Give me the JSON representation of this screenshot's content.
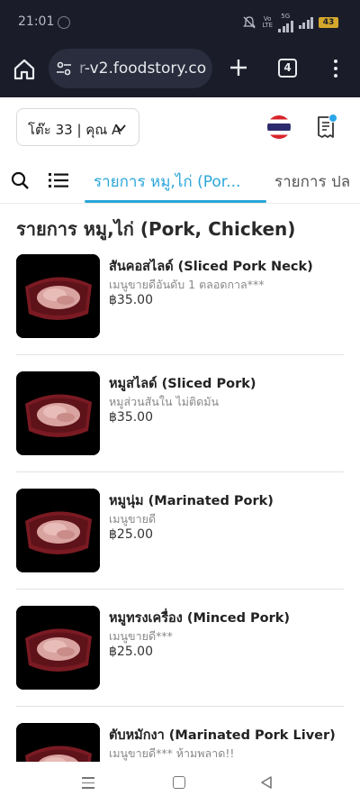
{
  "status_bar": {
    "time": "21:01",
    "network_label_top": "Vo",
    "network_label_bottom": "LTE",
    "network_gen": "5G",
    "battery": "43"
  },
  "browser": {
    "url_prefix": "r",
    "url": "-v2.foodstory.co",
    "tab_count": "4"
  },
  "header": {
    "table_label": "โต๊ะ 33 | คุณ A"
  },
  "category_nav": {
    "active_tab": "รายการ หมู,ไก่ (Por...",
    "next_tab": "รายการ ปล"
  },
  "section": {
    "title": "รายการ หมู,ไก่ (Pork, Chicken)"
  },
  "menu_items": [
    {
      "name": "สันคอสไลด์ (Sliced Pork Neck)",
      "desc": "เมนูขายดีอันดับ 1 ตลอดกาล***",
      "price": "฿35.00"
    },
    {
      "name": "หมูสไลด์ (Sliced Pork)",
      "desc": "หมูส่วนสันใน ไม่ติดมัน",
      "price": "฿35.00"
    },
    {
      "name": "หมูนุ่ม (Marinated Pork)",
      "desc": "เมนูขายดี",
      "price": "฿25.00"
    },
    {
      "name": "หมูทรงเครื่อง (Minced Pork)",
      "desc": "เมนูขายดี***",
      "price": "฿25.00"
    },
    {
      "name": "ตับหมักงา (Marinated Pork Liver)",
      "desc": "เมนูขายดี*** ห้ามพลาด!!",
      "price": ""
    }
  ],
  "icons": {
    "home": "home-icon",
    "tune": "tune-icon",
    "plus": "plus-icon",
    "menu": "kebab-icon",
    "flag": "thai-flag-icon",
    "receipt": "receipt-icon",
    "search": "search-icon",
    "list": "list-icon"
  },
  "colors": {
    "accent": "#2aa6d9",
    "browser_bg": "#1a1c29",
    "tray": "#7a1a22"
  }
}
